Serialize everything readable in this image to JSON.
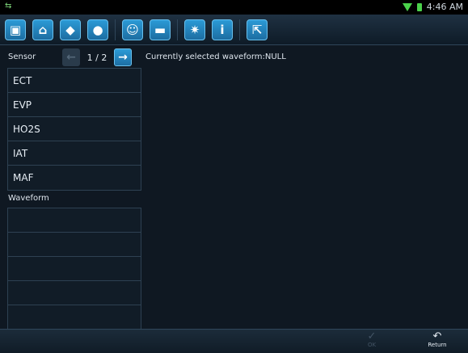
{
  "status_bar": {
    "time": "4:46 AM"
  },
  "toolbar": {
    "icons": [
      "window-icon",
      "home-icon",
      "diagnostic-icon",
      "globe-icon",
      "person-icon",
      "message-icon",
      "settings-icon",
      "info-icon",
      "exit-icon"
    ],
    "info_glyph": "i"
  },
  "sensor_panel": {
    "label": "Sensor",
    "page_indicator": "1 / 2",
    "items": [
      "ECT",
      "EVP",
      "HO2S",
      "IAT",
      "MAF"
    ]
  },
  "status_text": "Currently selected waveform:NULL",
  "waveform_panel": {
    "label": "Waveform",
    "rows": [
      "",
      "",
      "",
      "",
      ""
    ]
  },
  "bottom_bar": {
    "ok_label": "OK",
    "return_label": "Return"
  }
}
